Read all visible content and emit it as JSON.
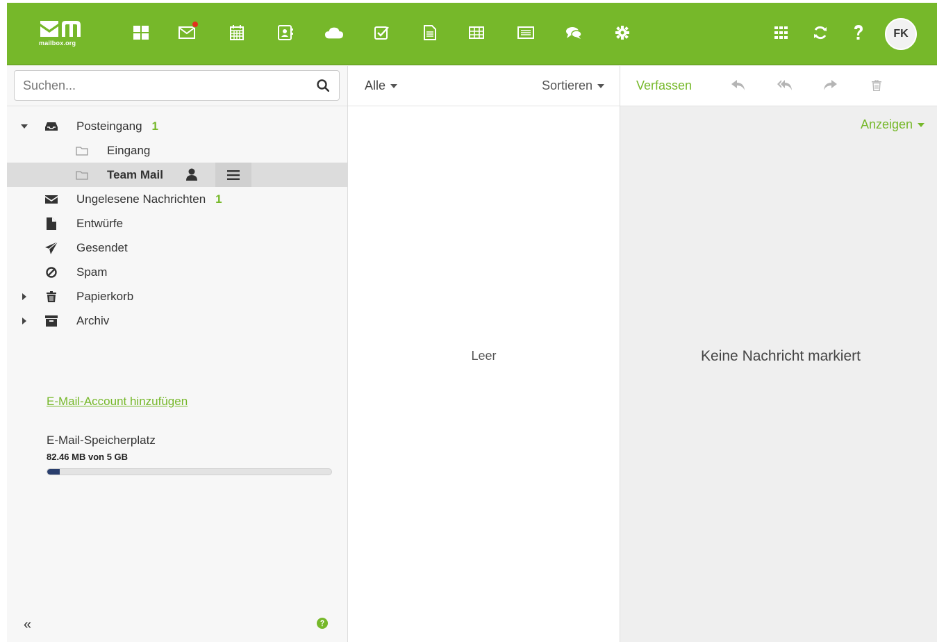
{
  "header": {
    "logo_text": "mailbox.org",
    "avatar_initials": "FK",
    "apps": [
      {
        "icon": "portal-icon"
      },
      {
        "icon": "mail-icon",
        "notification": true
      },
      {
        "icon": "calendar-icon"
      },
      {
        "icon": "addressbook-icon"
      },
      {
        "icon": "drive-icon"
      },
      {
        "icon": "tasks-icon"
      },
      {
        "icon": "documents-icon"
      },
      {
        "icon": "spreadsheet-icon"
      },
      {
        "icon": "presentation-icon"
      },
      {
        "icon": "chat-icon"
      },
      {
        "icon": "settings-icon"
      }
    ],
    "right_icons": [
      "app-launcher-icon",
      "refresh-icon",
      "help-icon"
    ]
  },
  "search": {
    "placeholder": "Suchen...",
    "value": ""
  },
  "folders": [
    {
      "label": "Posteingang",
      "count": "1",
      "icon": "inbox-icon",
      "expanded": true
    },
    {
      "label": "Eingang",
      "icon": "folder-icon",
      "level": 1
    },
    {
      "label": "Team Mail",
      "icon": "folder-icon",
      "level": 1,
      "selected": true,
      "shared": true
    },
    {
      "label": "Ungelesene Nachrichten",
      "count": "1",
      "icon": "envelope-icon"
    },
    {
      "label": "Entwürfe",
      "icon": "draft-icon"
    },
    {
      "label": "Gesendet",
      "icon": "paper-plane-icon"
    },
    {
      "label": "Spam",
      "icon": "ban-icon"
    },
    {
      "label": "Papierkorb",
      "icon": "trash-icon",
      "collapsed": true
    },
    {
      "label": "Archiv",
      "icon": "archive-icon",
      "collapsed": true
    }
  ],
  "sidebar": {
    "add_account": "E-Mail-Account hinzufügen",
    "quota_title": "E-Mail-Speicherplatz",
    "quota_value": "82.46 MB von 5 GB",
    "quota_fraction": 0.016,
    "collapse_label": "«"
  },
  "list": {
    "filter_label": "Alle",
    "sort_label": "Sortieren",
    "empty_text": "Leer"
  },
  "detail": {
    "compose_label": "Verfassen",
    "view_label": "Anzeigen",
    "empty_text": "Keine Nachricht markiert"
  },
  "colors": {
    "brand_green": "#76b82a",
    "quota_fill": "#2a3f6e",
    "notification": "#e3301f"
  }
}
